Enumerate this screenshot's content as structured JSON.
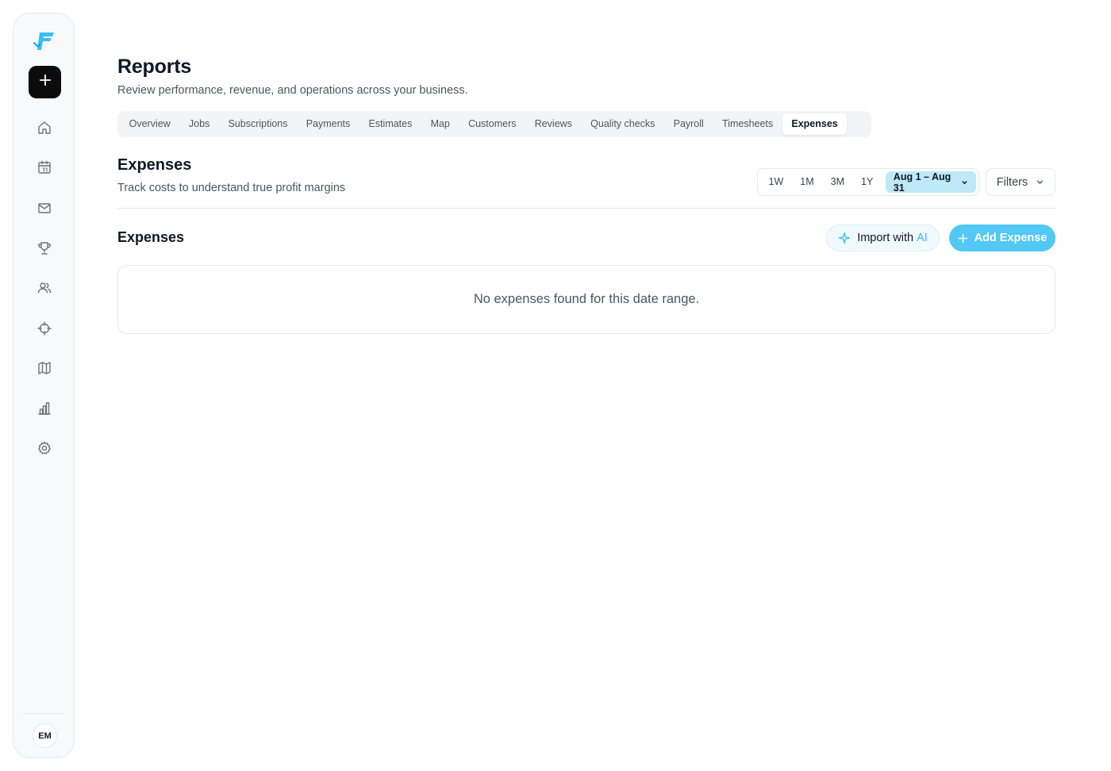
{
  "sidebar": {
    "logo_icon": "brand-logo-icon",
    "add_icon": "plus-icon",
    "items": [
      {
        "icon": "home-icon"
      },
      {
        "icon": "calendar-icon"
      },
      {
        "icon": "mail-icon"
      },
      {
        "icon": "trophy-icon"
      },
      {
        "icon": "users-icon"
      },
      {
        "icon": "target-icon"
      },
      {
        "icon": "map-icon"
      },
      {
        "icon": "bar-chart-icon"
      },
      {
        "icon": "settings-icon"
      }
    ],
    "avatar_initials": "EM"
  },
  "header": {
    "title": "Reports",
    "subtitle": "Review performance, revenue, and operations across your business."
  },
  "tabs": [
    {
      "label": "Overview"
    },
    {
      "label": "Jobs"
    },
    {
      "label": "Subscriptions"
    },
    {
      "label": "Payments"
    },
    {
      "label": "Estimates"
    },
    {
      "label": "Map"
    },
    {
      "label": "Customers"
    },
    {
      "label": "Reviews"
    },
    {
      "label": "Quality checks"
    },
    {
      "label": "Payroll"
    },
    {
      "label": "Timesheets"
    },
    {
      "label": "Expenses",
      "active": true
    }
  ],
  "section": {
    "title": "Expenses",
    "subtitle": "Track costs to understand true profit margins"
  },
  "range": {
    "options": [
      "1W",
      "1M",
      "3M",
      "1Y"
    ],
    "selected": "Aug 1 – Aug 31"
  },
  "filters_label": "Filters",
  "expenses": {
    "title": "Expenses",
    "import_label": "Import with",
    "import_ai": "AI",
    "add_label": "Add Expense",
    "empty_text": "No expenses found for this date range."
  },
  "colors": {
    "accent": "#52c8f4",
    "accent_light": "#bfe9f7",
    "sidebar_bg": "#f8f9fa"
  }
}
